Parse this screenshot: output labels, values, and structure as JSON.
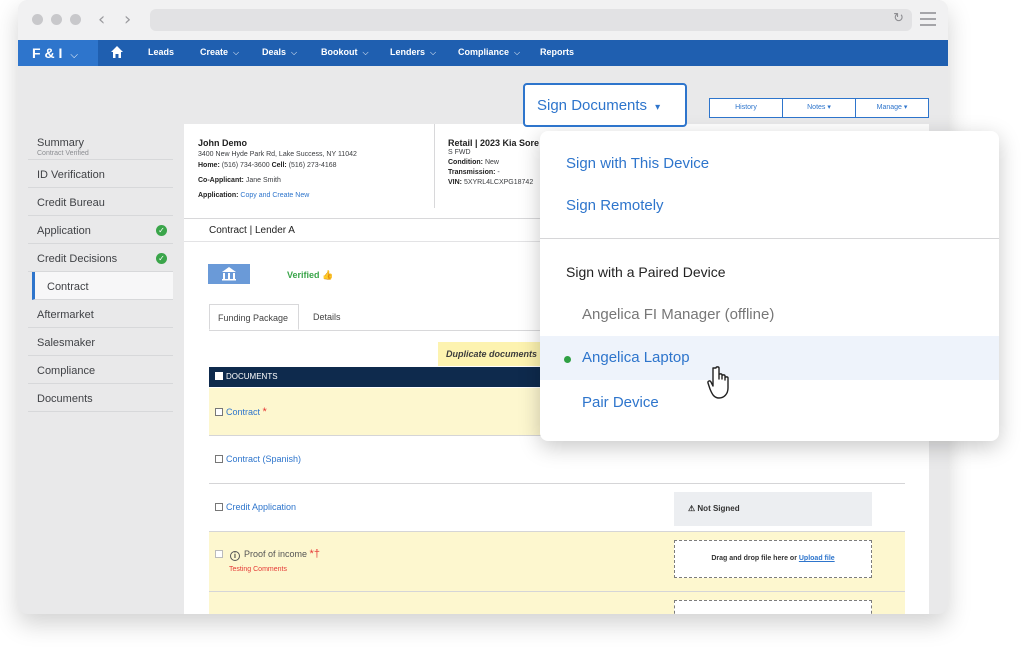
{
  "browser": {
    "back_icon": "chevron-left-icon",
    "forward_icon": "chevron-right-icon",
    "reload_icon": "reload-icon",
    "menu_icon": "hamburger-icon"
  },
  "topnav": {
    "brand": "F & I",
    "brand_chevron": "⌵",
    "items": [
      {
        "label": "Leads",
        "chevron": ""
      },
      {
        "label": "Create",
        "chevron": "⌵"
      },
      {
        "label": "Deals",
        "chevron": "⌵"
      },
      {
        "label": "Bookout",
        "chevron": "⌵"
      },
      {
        "label": "Lenders",
        "chevron": "⌵"
      },
      {
        "label": "Compliance",
        "chevron": "⌵"
      },
      {
        "label": "Reports",
        "chevron": ""
      }
    ]
  },
  "sidebar": {
    "summary": {
      "label": "Summary",
      "sub": "Contract Verified"
    },
    "items": [
      {
        "label": "ID Verification",
        "checked": false
      },
      {
        "label": "Credit Bureau",
        "checked": false
      },
      {
        "label": "Application",
        "checked": true
      },
      {
        "label": "Credit Decisions",
        "checked": true
      },
      {
        "label": "Contract",
        "checked": false,
        "active": true
      },
      {
        "label": "Aftermarket",
        "checked": false
      },
      {
        "label": "Salesmaker",
        "checked": false
      },
      {
        "label": "Compliance",
        "checked": false
      },
      {
        "label": "Documents",
        "checked": false
      }
    ]
  },
  "toolbar": {
    "sign_documents": "Sign Documents",
    "sign_caret": "▾",
    "history": "History",
    "notes": "Notes ▾",
    "manage": "Manage ▾"
  },
  "customer": {
    "name": "John Demo",
    "address": "3400 New Hyde Park Rd, Lake Success, NY 11042",
    "phones_label_home": "Home:",
    "phone_home": "(516) 734-3600",
    "phones_label_cell": "Cell:",
    "phone_cell": "(516) 273-4168",
    "coapp_label": "Co-Applicant:",
    "coapp": "Jane Smith",
    "application_label": "Application:",
    "application_link": "Copy and Create New"
  },
  "vehicle": {
    "title": "Retail | 2023 Kia Sore",
    "trim": "S FWD",
    "condition_label": "Condition:",
    "condition": "New",
    "transmission_label": "Transmission:",
    "transmission": "-",
    "vin_label": "VIN:",
    "vin": "5XYRL4LCXPG18742"
  },
  "contract": {
    "header": "Contract | Lender A",
    "verified": "Verified",
    "tabs": [
      "Funding Package",
      "Details"
    ],
    "duplicate_notice": "Duplicate documents",
    "documents_header": "DOCUMENTS",
    "documents": [
      {
        "label": "Contract",
        "mark": "*"
      },
      {
        "label": "Contract (Spanish)"
      },
      {
        "label": "Credit Application",
        "status": "Not Signed"
      },
      {
        "label": "Proof of income",
        "mark": "*†",
        "comment": "Testing Comments",
        "drop_text": "Drag and drop file here or",
        "upload_link": "Upload file"
      }
    ]
  },
  "sign_menu": {
    "sign_this_device": "Sign with This Device",
    "sign_remotely": "Sign Remotely",
    "paired_header": "Sign with a Paired Device",
    "devices": [
      {
        "label": "Angelica FI Manager (offline)",
        "online": false
      },
      {
        "label": "Angelica Laptop",
        "online": true
      }
    ],
    "pair_device": "Pair Device"
  }
}
